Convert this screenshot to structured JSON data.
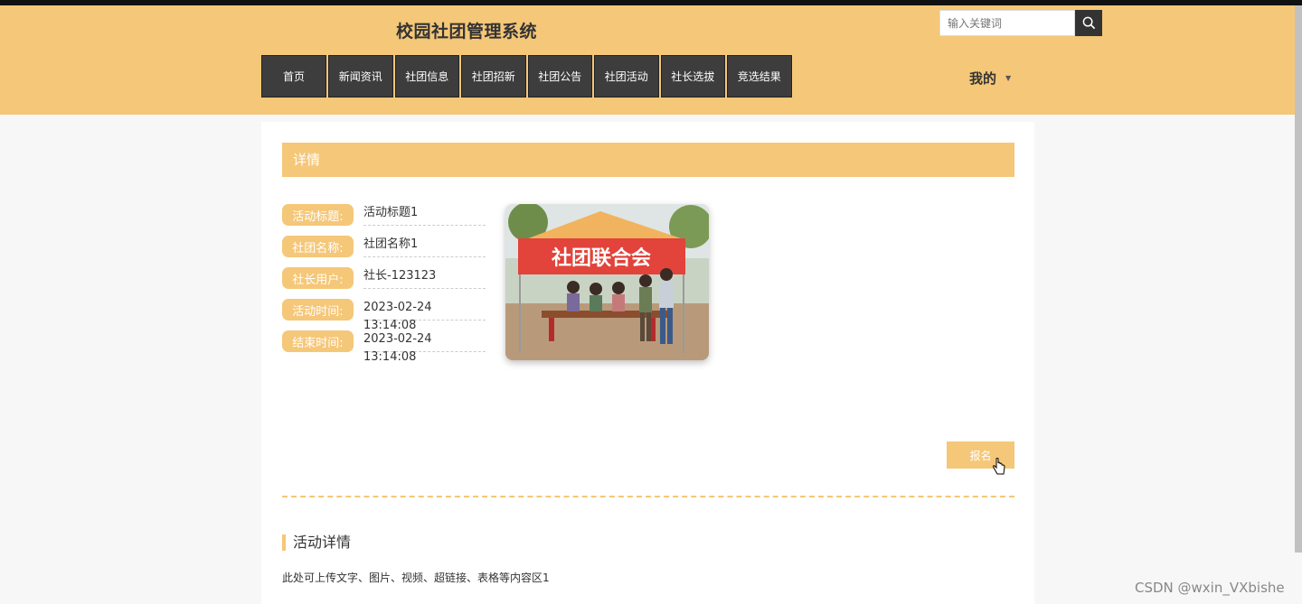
{
  "header": {
    "site_title": "校园社团管理系统",
    "search_placeholder": "输入关键词",
    "mine_label": "我的",
    "nav": [
      "首页",
      "新闻资讯",
      "社团信息",
      "社团招新",
      "社团公告",
      "社团活动",
      "社长选拔",
      "竞选结果"
    ]
  },
  "detail": {
    "section_title": "详情",
    "fields": [
      {
        "label": "活动标题:",
        "value": "活动标题1"
      },
      {
        "label": "社团名称:",
        "value": "社团名称1"
      },
      {
        "label": "社长用户:",
        "value": "社长-123123"
      },
      {
        "label": "活动时间:",
        "value": "2023-02-24 13:14:08"
      },
      {
        "label": "结束时间:",
        "value": "2023-02-24 13:14:08"
      }
    ],
    "photo_banner_text": "社团联合会",
    "signup_label": "报名",
    "sub_title": "活动详情",
    "description": "此处可上传文字、图片、视频、超链接、表格等内容区1"
  },
  "watermark": "CSDN @wxin_VXbishe",
  "colors": {
    "accent": "#f5c778",
    "nav_bg": "#3d3d3d"
  }
}
